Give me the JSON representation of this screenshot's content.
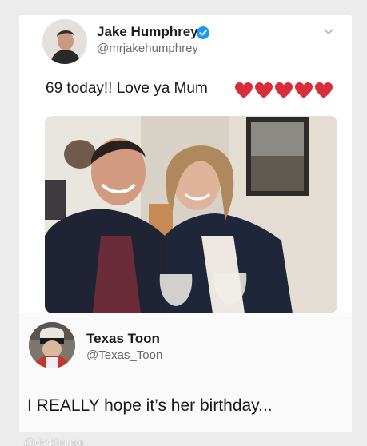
{
  "tweet": {
    "author_name": "Jake Humphrey",
    "author_handle": "@mrjakehumphrey",
    "text": "69 today!! Love ya Mum",
    "heart_count": 5,
    "icons": [
      "verified-icon",
      "chevron-down-icon",
      "heart-icon"
    ],
    "colors": {
      "verified": "#1d9bf0",
      "heart": "#d82e3b"
    }
  },
  "reply": {
    "author_name": "Texas Toon",
    "author_handle": "@Texas_Toon",
    "text": "I REALLY hope it’s her birthday..."
  },
  "watermark": "@darkhumor"
}
